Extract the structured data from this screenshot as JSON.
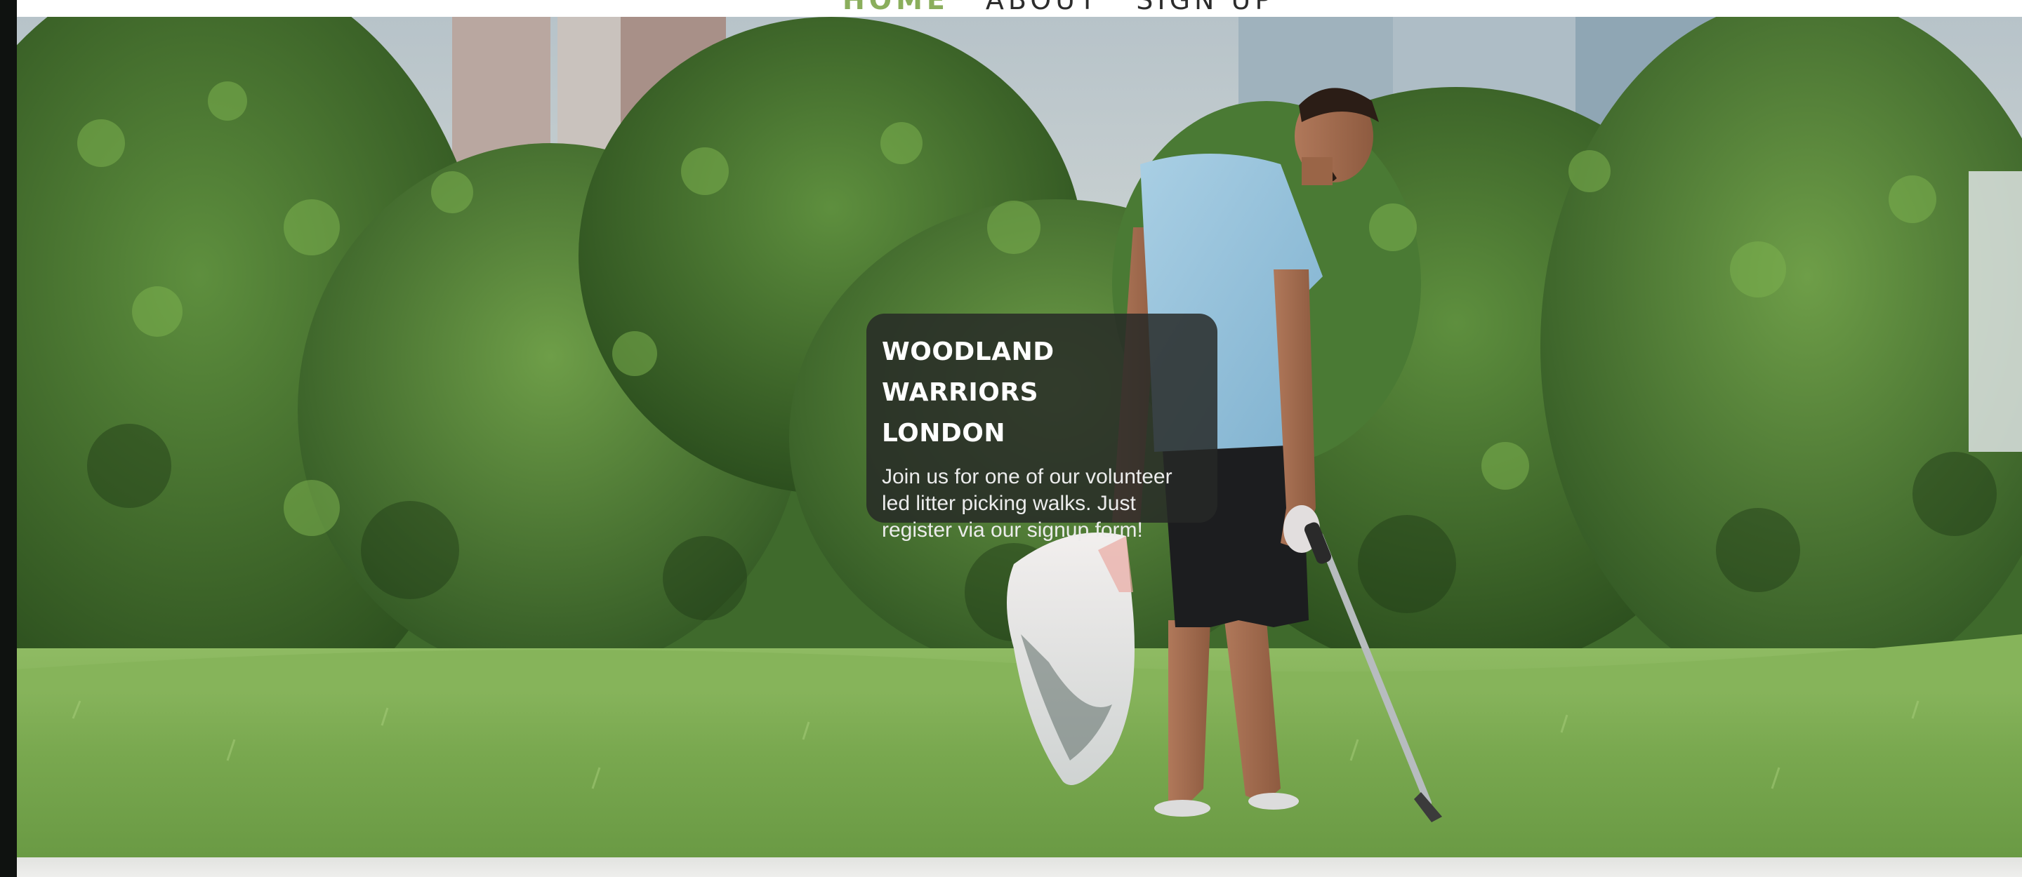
{
  "nav": {
    "items": [
      {
        "label": "HOME",
        "active": true
      },
      {
        "label": "ABOUT",
        "active": false
      },
      {
        "label": "SIGN UP",
        "active": false
      }
    ]
  },
  "hero": {
    "image_subject": "man-picking-litter-in-park",
    "title_line1": "WOODLAND WARRIORS",
    "title_line2": "LONDON",
    "text": "Join us for one of our volunteer led litter picking walks. Just register via our signup form!"
  },
  "colors": {
    "nav_active": "#8aae5c",
    "nav_text": "#2c2c2c",
    "caption_bg": "#262826",
    "caption_text": "#ffffff"
  }
}
